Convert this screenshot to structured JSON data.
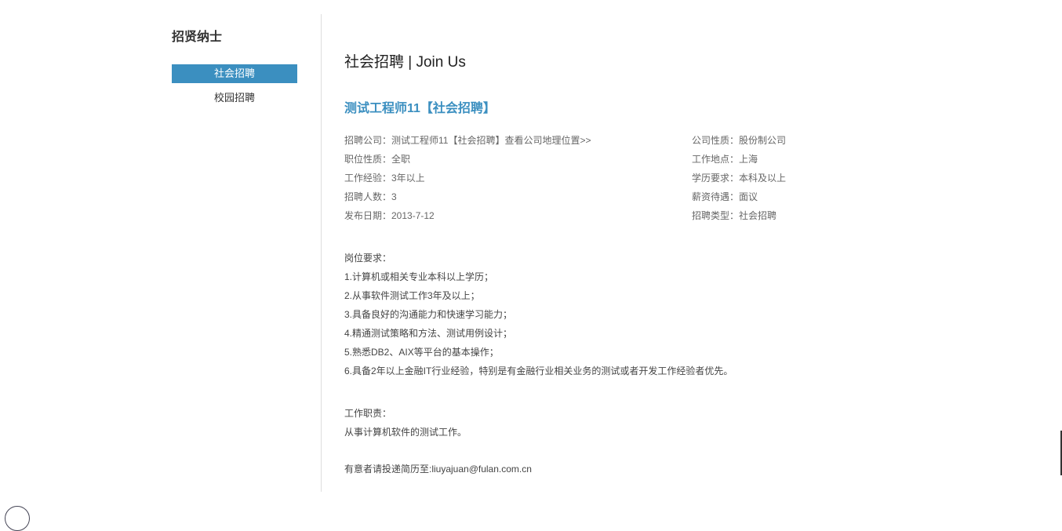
{
  "sidebar": {
    "title": "招贤纳士",
    "items": [
      {
        "label": "社会招聘",
        "active": true
      },
      {
        "label": "校园招聘",
        "active": false
      }
    ]
  },
  "main": {
    "page_title": "社会招聘 | Join Us",
    "job_title": "测试工程师11【社会招聘】",
    "left_info": {
      "company_label": "招聘公司：",
      "company_value": "测试工程师11【社会招聘】",
      "map_link": "查看公司地理位置>>",
      "position_type": "职位性质：全职",
      "experience": "工作经验：3年以上",
      "headcount": "招聘人数：3",
      "publish_date": "发布日期：2013-7-12"
    },
    "right_info": {
      "company_nature": "公司性质：股份制公司",
      "location": "工作地点：上海",
      "education": "学历要求：本科及以上",
      "salary": "薪资待遇：面议",
      "recruit_type": "招聘类型：社会招聘"
    },
    "requirements": {
      "heading": "岗位要求：",
      "lines": [
        "1.计算机或相关专业本科以上学历；",
        "2.从事软件测试工作3年及以上；",
        "3.具备良好的沟通能力和快速学习能力；",
        "4.精通测试策略和方法、测试用例设计；",
        "5.熟悉DB2、AIX等平台的基本操作；",
        "6.具备2年以上金融IT行业经验，特别是有金融行业相关业务的测试或者开发工作经验者优先。"
      ]
    },
    "duties": {
      "heading": "工作职责：",
      "lines": [
        "从事计算机软件的测试工作。"
      ]
    },
    "contact": "有意者请投递简历至:liuyajuan@fulan.com.cn"
  },
  "colors": {
    "accent": "#3b8fc0",
    "divider": "#dedede"
  }
}
